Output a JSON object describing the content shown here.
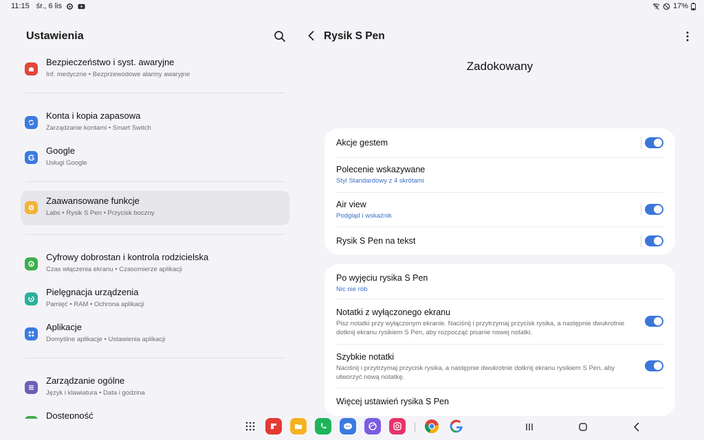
{
  "status": {
    "time": "11:15",
    "date": "śr., 6 lis",
    "battery": "17%"
  },
  "left": {
    "title": "Ustawienia",
    "items": [
      {
        "title": "Bezpieczeństwo i syst. awaryjne",
        "subtitle": "Inf. medyczne  •  Bezprzewodowe alarmy awaryjne",
        "icon": "emergency-icon",
        "color": "#e2473a"
      },
      {
        "title": "Konta i kopia zapasowa",
        "subtitle": "Zarządzanie kontami  •  Smart Switch",
        "icon": "sync-icon",
        "color": "#3b7be0"
      },
      {
        "title": "Google",
        "subtitle": "Usługi Google",
        "icon": "google-icon",
        "color": "#3b7be0"
      },
      {
        "title": "Zaawansowane funkcje",
        "subtitle": "Labs  •  Rysik S Pen  •  Przycisk boczny",
        "icon": "advanced-features-icon",
        "color": "#f2b33b"
      },
      {
        "title": "Cyfrowy dobrostan i kontrola rodzicielska",
        "subtitle": "Czas włączenia ekranu  •  Czasomierze aplikacji",
        "icon": "wellbeing-icon",
        "color": "#3dae4b"
      },
      {
        "title": "Pielęgnacja urządzenia",
        "subtitle": "Pamięć  •  RAM  •  Ochrona aplikacji",
        "icon": "device-care-icon",
        "color": "#2ab09a"
      },
      {
        "title": "Aplikacje",
        "subtitle": "Domyślne aplikacje  •  Ustawienia aplikacji",
        "icon": "apps-icon",
        "color": "#3b7be0"
      },
      {
        "title": "Zarządzanie ogólne",
        "subtitle": "Język i klawiatura  •  Data i godzina",
        "icon": "general-management-icon",
        "color": "#6b5fb5"
      },
      {
        "title": "Dostępność",
        "subtitle": "",
        "icon": "accessibility-icon",
        "color": "#3dae4b"
      }
    ]
  },
  "right": {
    "title": "Rysik S Pen",
    "heading": "Zadokowany",
    "card1": [
      {
        "title": "Akcje gestem",
        "subtitle": "",
        "toggle": true
      },
      {
        "title": "Polecenie wskazywane",
        "subtitle": "Styl Standardowy z 4 skrótami",
        "toggle": false
      },
      {
        "title": "Air view",
        "subtitle": "Podgląd i wskaźnik",
        "toggle": true
      },
      {
        "title": "Rysik S Pen na tekst",
        "subtitle": "",
        "toggle": true
      }
    ],
    "card2": [
      {
        "title": "Po wyjęciu rysika S Pen",
        "subtitle": "Nic nie rób"
      },
      {
        "title": "Notatki z wyłączonego ekranu",
        "desc": "Pisz notatki przy wyłączonym ekranie. Naciśnij i przytrzymaj przycisk rysika, a następnie dwukrotnie dotknij ekranu rysikiem S Pen, aby rozpocząć pisanie nowej notatki.",
        "toggle": true
      },
      {
        "title": "Szybkie notatki",
        "desc": "Naciśnij i przytrzymaj przycisk rysika, a następnie dwukrotnie dotknij ekranu rysikiem S Pen, aby utworzyć nową notatkę.",
        "toggle": true
      },
      {
        "title": "Więcej ustawień rysika S Pen"
      }
    ]
  },
  "taskbar": {
    "apps": [
      {
        "name": "app-drawer-icon",
        "color": "none"
      },
      {
        "name": "flipboard-icon",
        "color": "#e53935"
      },
      {
        "name": "files-icon",
        "color": "#f5b323"
      },
      {
        "name": "phone-icon",
        "color": "#1db45a"
      },
      {
        "name": "messages-icon",
        "color": "#3b7be0"
      },
      {
        "name": "internet-icon",
        "color": "#7a5de0"
      },
      {
        "name": "camera-icon",
        "color": "#e8336a"
      },
      {
        "name": "chrome-icon",
        "color": "none"
      },
      {
        "name": "google-app-icon",
        "color": "none"
      }
    ]
  }
}
